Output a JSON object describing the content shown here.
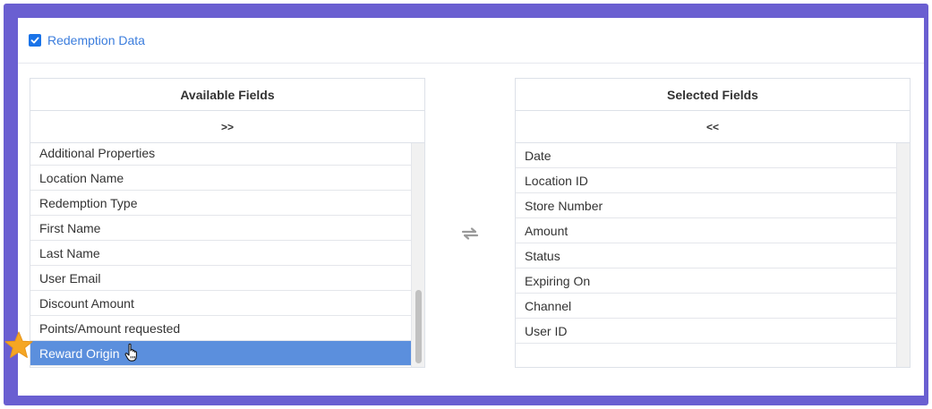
{
  "section": {
    "checkbox_checked": true,
    "label": "Redemption Data"
  },
  "available": {
    "title": "Available Fields",
    "move_all_label": ">>",
    "items": [
      "Additional Properties",
      "Location Name",
      "Redemption Type",
      "First Name",
      "Last Name",
      "User Email",
      "Discount Amount",
      "Points/Amount requested",
      "Reward Origin"
    ],
    "selected_item": "Reward Origin"
  },
  "selected": {
    "title": "Selected Fields",
    "remove_all_label": "<<",
    "items": [
      "Date",
      "Location ID",
      "Store Number",
      "Amount",
      "Status",
      "Expiring On",
      "Channel",
      "User ID"
    ]
  },
  "icons": {
    "checkbox": "checkmark-icon",
    "swap": "swap-arrows-icon",
    "highlight": "star-icon",
    "pointer": "hand-pointer-icon"
  },
  "colors": {
    "frame": "#6a5fd1",
    "accent": "#3b7ddd",
    "selected_row": "#5b8fdd",
    "star": "#f5a623"
  }
}
